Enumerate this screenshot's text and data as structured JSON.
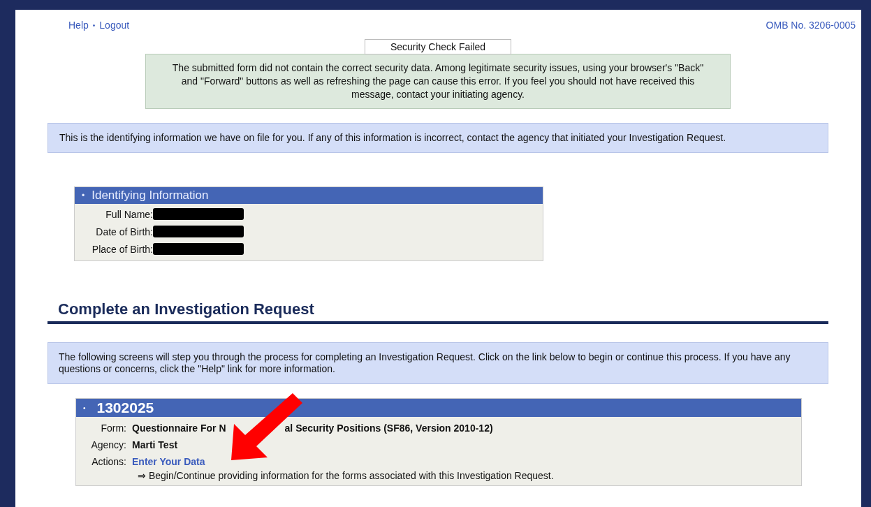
{
  "top_links": [
    {
      "label": "Help"
    },
    {
      "label": "Logout"
    }
  ],
  "top_separator": "•",
  "omb_number": "OMB No. 3206-0005",
  "alert": {
    "title": "Security Check Failed",
    "message": "The submitted form did not contain the correct security data. Among legitimate security issues, using your browser's \"Back\" and \"Forward\" buttons as well as refreshing the page can cause this error. If you feel you should not have received this message, contact your initiating agency."
  },
  "info_notice": "This is the identifying information we have on file for you. If any of this information is incorrect, contact the agency that initiated your Investigation Request.",
  "identifying_information": {
    "bullet": "•",
    "title": "Identifying Information",
    "fields": [
      {
        "label": "Full Name:"
      },
      {
        "label": "Date of Birth:"
      },
      {
        "label": "Place of Birth:"
      }
    ]
  },
  "section_heading": "Complete an Investigation Request",
  "instructions": "The following screens will step you through the process for completing an Investigation Request. Click on the link below to begin or continue this process. If you have any questions or concerns, click the \"Help\" link for more information.",
  "request": {
    "bullet": "•",
    "number": "1302025",
    "form_label": "Form:",
    "form_value_visible_parts": [
      "Questionnaire For N",
      "al Security Positions (SF86, Version 2010-12)"
    ],
    "agency_label": "Agency:",
    "agency_value": "Marti Test",
    "actions_label": "Actions:",
    "action_link": "Enter Your Data",
    "action_description": "⇒ Begin/Continue providing information for the forms associated with this Investigation Request."
  }
}
